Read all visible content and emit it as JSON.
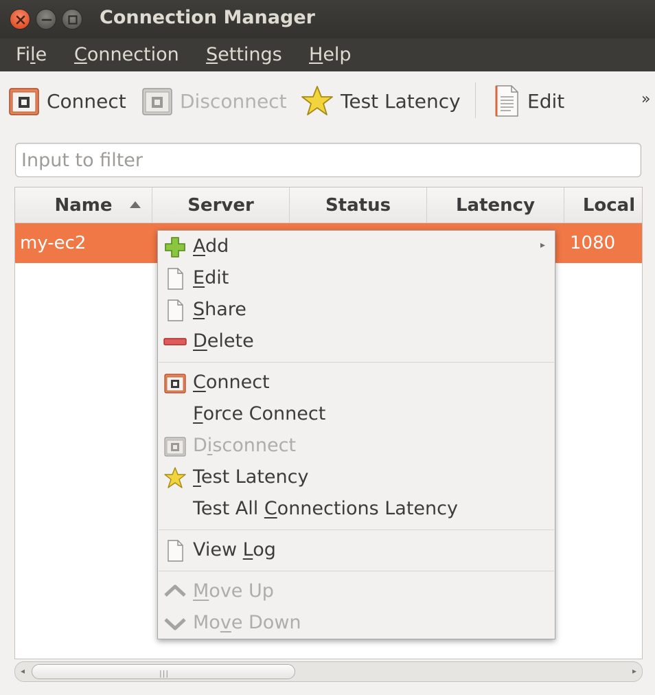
{
  "window": {
    "title": "Connection Manager"
  },
  "menubar": {
    "file": {
      "pre": "Fi",
      "mn": "l",
      "post": "e"
    },
    "connection": {
      "pre": "",
      "mn": "C",
      "post": "onnection"
    },
    "settings": {
      "pre": "",
      "mn": "S",
      "post": "ettings"
    },
    "help": {
      "pre": "",
      "mn": "H",
      "post": "elp"
    }
  },
  "toolbar": {
    "connect": "Connect",
    "disconnect": "Disconnect",
    "test_latency": "Test Latency",
    "edit": "Edit",
    "more": "»"
  },
  "filter": {
    "placeholder": "Input to filter"
  },
  "table": {
    "columns": [
      "Name",
      "Server",
      "Status",
      "Latency",
      "Local"
    ],
    "sort_column": "Name",
    "rows": [
      {
        "name": "my-ec2",
        "local": "1080"
      }
    ]
  },
  "scrollbar": {
    "left_arrow": "◂",
    "right_arrow": "▸",
    "grip": "|||"
  },
  "context_menu": {
    "add": {
      "mn": "A",
      "rest": "dd",
      "arrow": "▸"
    },
    "edit": {
      "mn": "E",
      "rest": "dit"
    },
    "share": {
      "mn": "S",
      "rest": "hare"
    },
    "delete": {
      "mn": "D",
      "rest": "elete"
    },
    "connect": {
      "mn": "C",
      "rest": "onnect"
    },
    "force_connect": {
      "mn": "F",
      "rest": "orce Connect"
    },
    "disconnect": {
      "pre": "D",
      "mn": "i",
      "rest": "sconnect"
    },
    "test_latency": {
      "mn": "T",
      "rest": "est Latency"
    },
    "test_all": {
      "pre": "Test All ",
      "mn": "C",
      "rest": "onnections Latency"
    },
    "view_log": {
      "pre": "View ",
      "mn": "L",
      "rest": "og"
    },
    "move_up": {
      "mn": "M",
      "rest": "ove Up"
    },
    "move_down": {
      "pre": "Mo",
      "mn": "v",
      "rest": "e Down"
    }
  },
  "colors": {
    "accent": "#f07746",
    "titlebar": "#3c3b37",
    "window_bg": "#f2f1f0"
  },
  "icons": {
    "connect": "connect-icon",
    "disconnect": "disconnect-icon",
    "test_latency": "star-icon",
    "edit": "document-icon",
    "add": "plus-icon",
    "delete": "minus-icon",
    "move_up": "chevron-up-icon",
    "move_down": "chevron-down-icon"
  }
}
